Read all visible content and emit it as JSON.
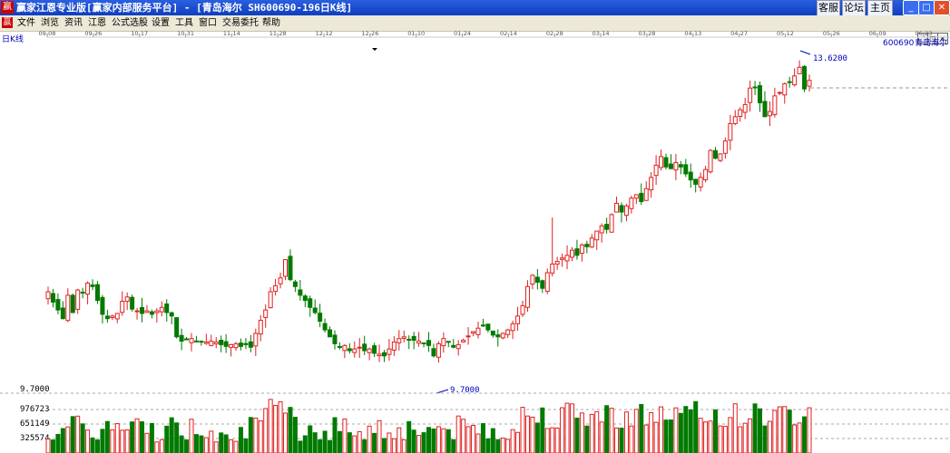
{
  "window": {
    "title": "赢家江恩专业版[赢家内部服务平台] - [青岛海尔   SH600690-196日K线]",
    "logo_text": "赢",
    "buttons": [
      "客服",
      "论坛",
      "主页"
    ],
    "window_controls": [
      "minimize-icon",
      "restore-icon",
      "close-icon"
    ]
  },
  "menu": {
    "logo_text": "赢",
    "items": [
      "文件",
      "浏览",
      "资讯",
      "江恩",
      "公式选股",
      "设置",
      "工具",
      "窗口",
      "交易委托",
      "帮助"
    ]
  },
  "chart_data": {
    "type": "candlestick",
    "period_label": "日K线",
    "symbol": "600690",
    "name": "青岛海尔",
    "date_labels": [
      "09-08",
      "09-26",
      "10-17",
      "10-31",
      "11-14",
      "11-28",
      "12-12",
      "12-26",
      "01-10",
      "01-24",
      "02-14",
      "02-28",
      "03-14",
      "03-28",
      "04-13",
      "04-27",
      "05-12",
      "05-26",
      "06-09",
      "06-23"
    ],
    "high_label": "13.6200",
    "low_label": "9.7000",
    "high_value": 13.62,
    "low_value": 9.7,
    "price_axis_label": "9.7000",
    "volume_axis_labels": [
      "976723",
      "651149",
      "325574"
    ],
    "ylim": [
      9.7,
      13.62
    ],
    "up_color": "#e02020",
    "down_color": "#007a00",
    "volume_up_color": "#e02020",
    "volume_down_color": "#007a00",
    "closes": [
      10.86,
      10.74,
      10.65,
      10.55,
      10.82,
      10.62,
      10.88,
      10.85,
      10.96,
      10.92,
      10.76,
      10.6,
      10.55,
      10.58,
      10.61,
      10.75,
      10.8,
      10.66,
      10.64,
      10.61,
      10.64,
      10.6,
      10.64,
      10.68,
      10.62,
      10.58,
      10.34,
      10.29,
      10.31,
      10.32,
      10.29,
      10.28,
      10.28,
      10.29,
      10.28,
      10.25,
      10.23,
      10.25,
      10.26,
      10.23,
      10.25,
      10.22,
      10.38,
      10.53,
      10.65,
      10.86,
      10.93,
      11.02,
      11.23,
      11.0,
      10.92,
      10.82,
      10.76,
      10.68,
      10.62,
      10.52,
      10.42,
      10.34,
      10.26,
      10.22,
      10.24,
      10.18,
      10.2,
      10.22,
      10.18,
      10.2,
      10.15,
      10.14,
      10.12,
      10.2,
      10.28,
      10.32,
      10.34,
      10.31,
      10.3,
      10.29,
      10.26,
      10.24,
      10.12,
      10.26,
      10.32,
      10.28,
      10.22,
      10.25,
      10.3,
      10.35,
      10.4,
      10.44,
      10.47,
      10.42,
      10.36,
      10.34,
      10.38,
      10.42,
      10.49,
      10.58,
      10.7,
      10.92,
      11.05,
      10.97,
      10.9,
      11.08,
      11.18,
      11.21,
      11.25,
      11.28,
      11.34,
      11.28,
      11.4,
      11.38,
      11.48,
      11.56,
      11.62,
      11.58,
      11.75,
      11.88,
      11.78,
      11.85,
      11.94,
      11.98,
      11.9,
      12.05,
      12.18,
      12.32,
      12.42,
      12.3,
      12.28,
      12.35,
      12.3,
      12.22,
      12.15,
      12.1,
      12.18,
      12.27,
      12.49,
      12.4,
      12.45,
      12.6,
      12.8,
      12.88,
      12.96,
      13.02,
      13.21,
      13.22,
      13.04,
      12.88,
      12.94,
      13.12,
      13.16,
      13.26,
      13.28,
      13.35,
      13.45,
      13.2,
      13.3
    ]
  }
}
